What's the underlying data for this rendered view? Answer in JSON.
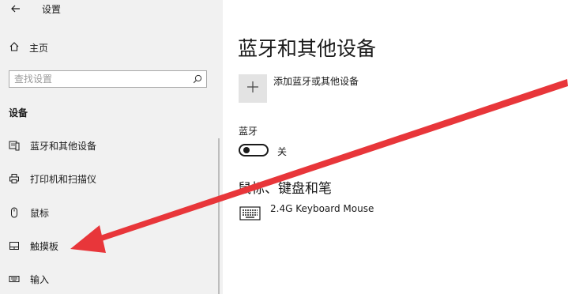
{
  "window": {
    "title": "设置"
  },
  "sidebar": {
    "home_label": "主页",
    "search_placeholder": "查找设置",
    "section_title": "设备",
    "items": [
      {
        "label": "蓝牙和其他设备",
        "icon": "bluetooth-devices-icon"
      },
      {
        "label": "打印机和扫描仪",
        "icon": "printer-icon"
      },
      {
        "label": "鼠标",
        "icon": "mouse-icon"
      },
      {
        "label": "触摸板",
        "icon": "touchpad-icon"
      },
      {
        "label": "输入",
        "icon": "keyboard-icon"
      }
    ]
  },
  "main": {
    "title": "蓝牙和其他设备",
    "add_device_label": "添加蓝牙或其他设备",
    "bluetooth_heading": "蓝牙",
    "bluetooth_state": "关",
    "bluetooth_on": false,
    "group_heading": "鼠标、键盘和笔",
    "devices": [
      {
        "name": "2.4G Keyboard Mouse",
        "icon": "keyboard-icon"
      }
    ]
  },
  "annotation": {
    "type": "arrow",
    "color": "#e8363a",
    "points_to": "sidebar-item-touchpad"
  },
  "colors": {
    "sidebar_bg": "#f1f1f1",
    "tile_bg": "#e3e3e3",
    "text": "#1a1a1a"
  }
}
